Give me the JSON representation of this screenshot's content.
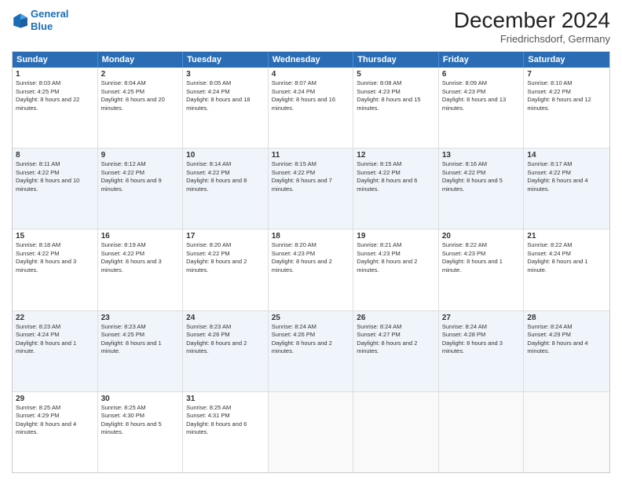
{
  "header": {
    "logo_line1": "General",
    "logo_line2": "Blue",
    "month": "December 2024",
    "location": "Friedrichsdorf, Germany"
  },
  "days": [
    "Sunday",
    "Monday",
    "Tuesday",
    "Wednesday",
    "Thursday",
    "Friday",
    "Saturday"
  ],
  "weeks": [
    [
      {
        "day": "1",
        "sunrise": "8:03 AM",
        "sunset": "4:25 PM",
        "daylight": "8 hours and 22 minutes."
      },
      {
        "day": "2",
        "sunrise": "8:04 AM",
        "sunset": "4:25 PM",
        "daylight": "8 hours and 20 minutes."
      },
      {
        "day": "3",
        "sunrise": "8:05 AM",
        "sunset": "4:24 PM",
        "daylight": "8 hours and 18 minutes."
      },
      {
        "day": "4",
        "sunrise": "8:07 AM",
        "sunset": "4:24 PM",
        "daylight": "8 hours and 16 minutes."
      },
      {
        "day": "5",
        "sunrise": "8:08 AM",
        "sunset": "4:23 PM",
        "daylight": "8 hours and 15 minutes."
      },
      {
        "day": "6",
        "sunrise": "8:09 AM",
        "sunset": "4:23 PM",
        "daylight": "8 hours and 13 minutes."
      },
      {
        "day": "7",
        "sunrise": "8:10 AM",
        "sunset": "4:22 PM",
        "daylight": "8 hours and 12 minutes."
      }
    ],
    [
      {
        "day": "8",
        "sunrise": "8:11 AM",
        "sunset": "4:22 PM",
        "daylight": "8 hours and 10 minutes."
      },
      {
        "day": "9",
        "sunrise": "8:12 AM",
        "sunset": "4:22 PM",
        "daylight": "8 hours and 9 minutes."
      },
      {
        "day": "10",
        "sunrise": "8:14 AM",
        "sunset": "4:22 PM",
        "daylight": "8 hours and 8 minutes."
      },
      {
        "day": "11",
        "sunrise": "8:15 AM",
        "sunset": "4:22 PM",
        "daylight": "8 hours and 7 minutes."
      },
      {
        "day": "12",
        "sunrise": "8:15 AM",
        "sunset": "4:22 PM",
        "daylight": "8 hours and 6 minutes."
      },
      {
        "day": "13",
        "sunrise": "8:16 AM",
        "sunset": "4:22 PM",
        "daylight": "8 hours and 5 minutes."
      },
      {
        "day": "14",
        "sunrise": "8:17 AM",
        "sunset": "4:22 PM",
        "daylight": "8 hours and 4 minutes."
      }
    ],
    [
      {
        "day": "15",
        "sunrise": "8:18 AM",
        "sunset": "4:22 PM",
        "daylight": "8 hours and 3 minutes."
      },
      {
        "day": "16",
        "sunrise": "8:19 AM",
        "sunset": "4:22 PM",
        "daylight": "8 hours and 3 minutes."
      },
      {
        "day": "17",
        "sunrise": "8:20 AM",
        "sunset": "4:22 PM",
        "daylight": "8 hours and 2 minutes."
      },
      {
        "day": "18",
        "sunrise": "8:20 AM",
        "sunset": "4:23 PM",
        "daylight": "8 hours and 2 minutes."
      },
      {
        "day": "19",
        "sunrise": "8:21 AM",
        "sunset": "4:23 PM",
        "daylight": "8 hours and 2 minutes."
      },
      {
        "day": "20",
        "sunrise": "8:22 AM",
        "sunset": "4:23 PM",
        "daylight": "8 hours and 1 minute."
      },
      {
        "day": "21",
        "sunrise": "8:22 AM",
        "sunset": "4:24 PM",
        "daylight": "8 hours and 1 minute."
      }
    ],
    [
      {
        "day": "22",
        "sunrise": "8:23 AM",
        "sunset": "4:24 PM",
        "daylight": "8 hours and 1 minute."
      },
      {
        "day": "23",
        "sunrise": "8:23 AM",
        "sunset": "4:25 PM",
        "daylight": "8 hours and 1 minute."
      },
      {
        "day": "24",
        "sunrise": "8:23 AM",
        "sunset": "4:26 PM",
        "daylight": "8 hours and 2 minutes."
      },
      {
        "day": "25",
        "sunrise": "8:24 AM",
        "sunset": "4:26 PM",
        "daylight": "8 hours and 2 minutes."
      },
      {
        "day": "26",
        "sunrise": "8:24 AM",
        "sunset": "4:27 PM",
        "daylight": "8 hours and 2 minutes."
      },
      {
        "day": "27",
        "sunrise": "8:24 AM",
        "sunset": "4:28 PM",
        "daylight": "8 hours and 3 minutes."
      },
      {
        "day": "28",
        "sunrise": "8:24 AM",
        "sunset": "4:29 PM",
        "daylight": "8 hours and 4 minutes."
      }
    ],
    [
      {
        "day": "29",
        "sunrise": "8:25 AM",
        "sunset": "4:29 PM",
        "daylight": "8 hours and 4 minutes."
      },
      {
        "day": "30",
        "sunrise": "8:25 AM",
        "sunset": "4:30 PM",
        "daylight": "8 hours and 5 minutes."
      },
      {
        "day": "31",
        "sunrise": "8:25 AM",
        "sunset": "4:31 PM",
        "daylight": "8 hours and 6 minutes."
      },
      null,
      null,
      null,
      null
    ]
  ]
}
